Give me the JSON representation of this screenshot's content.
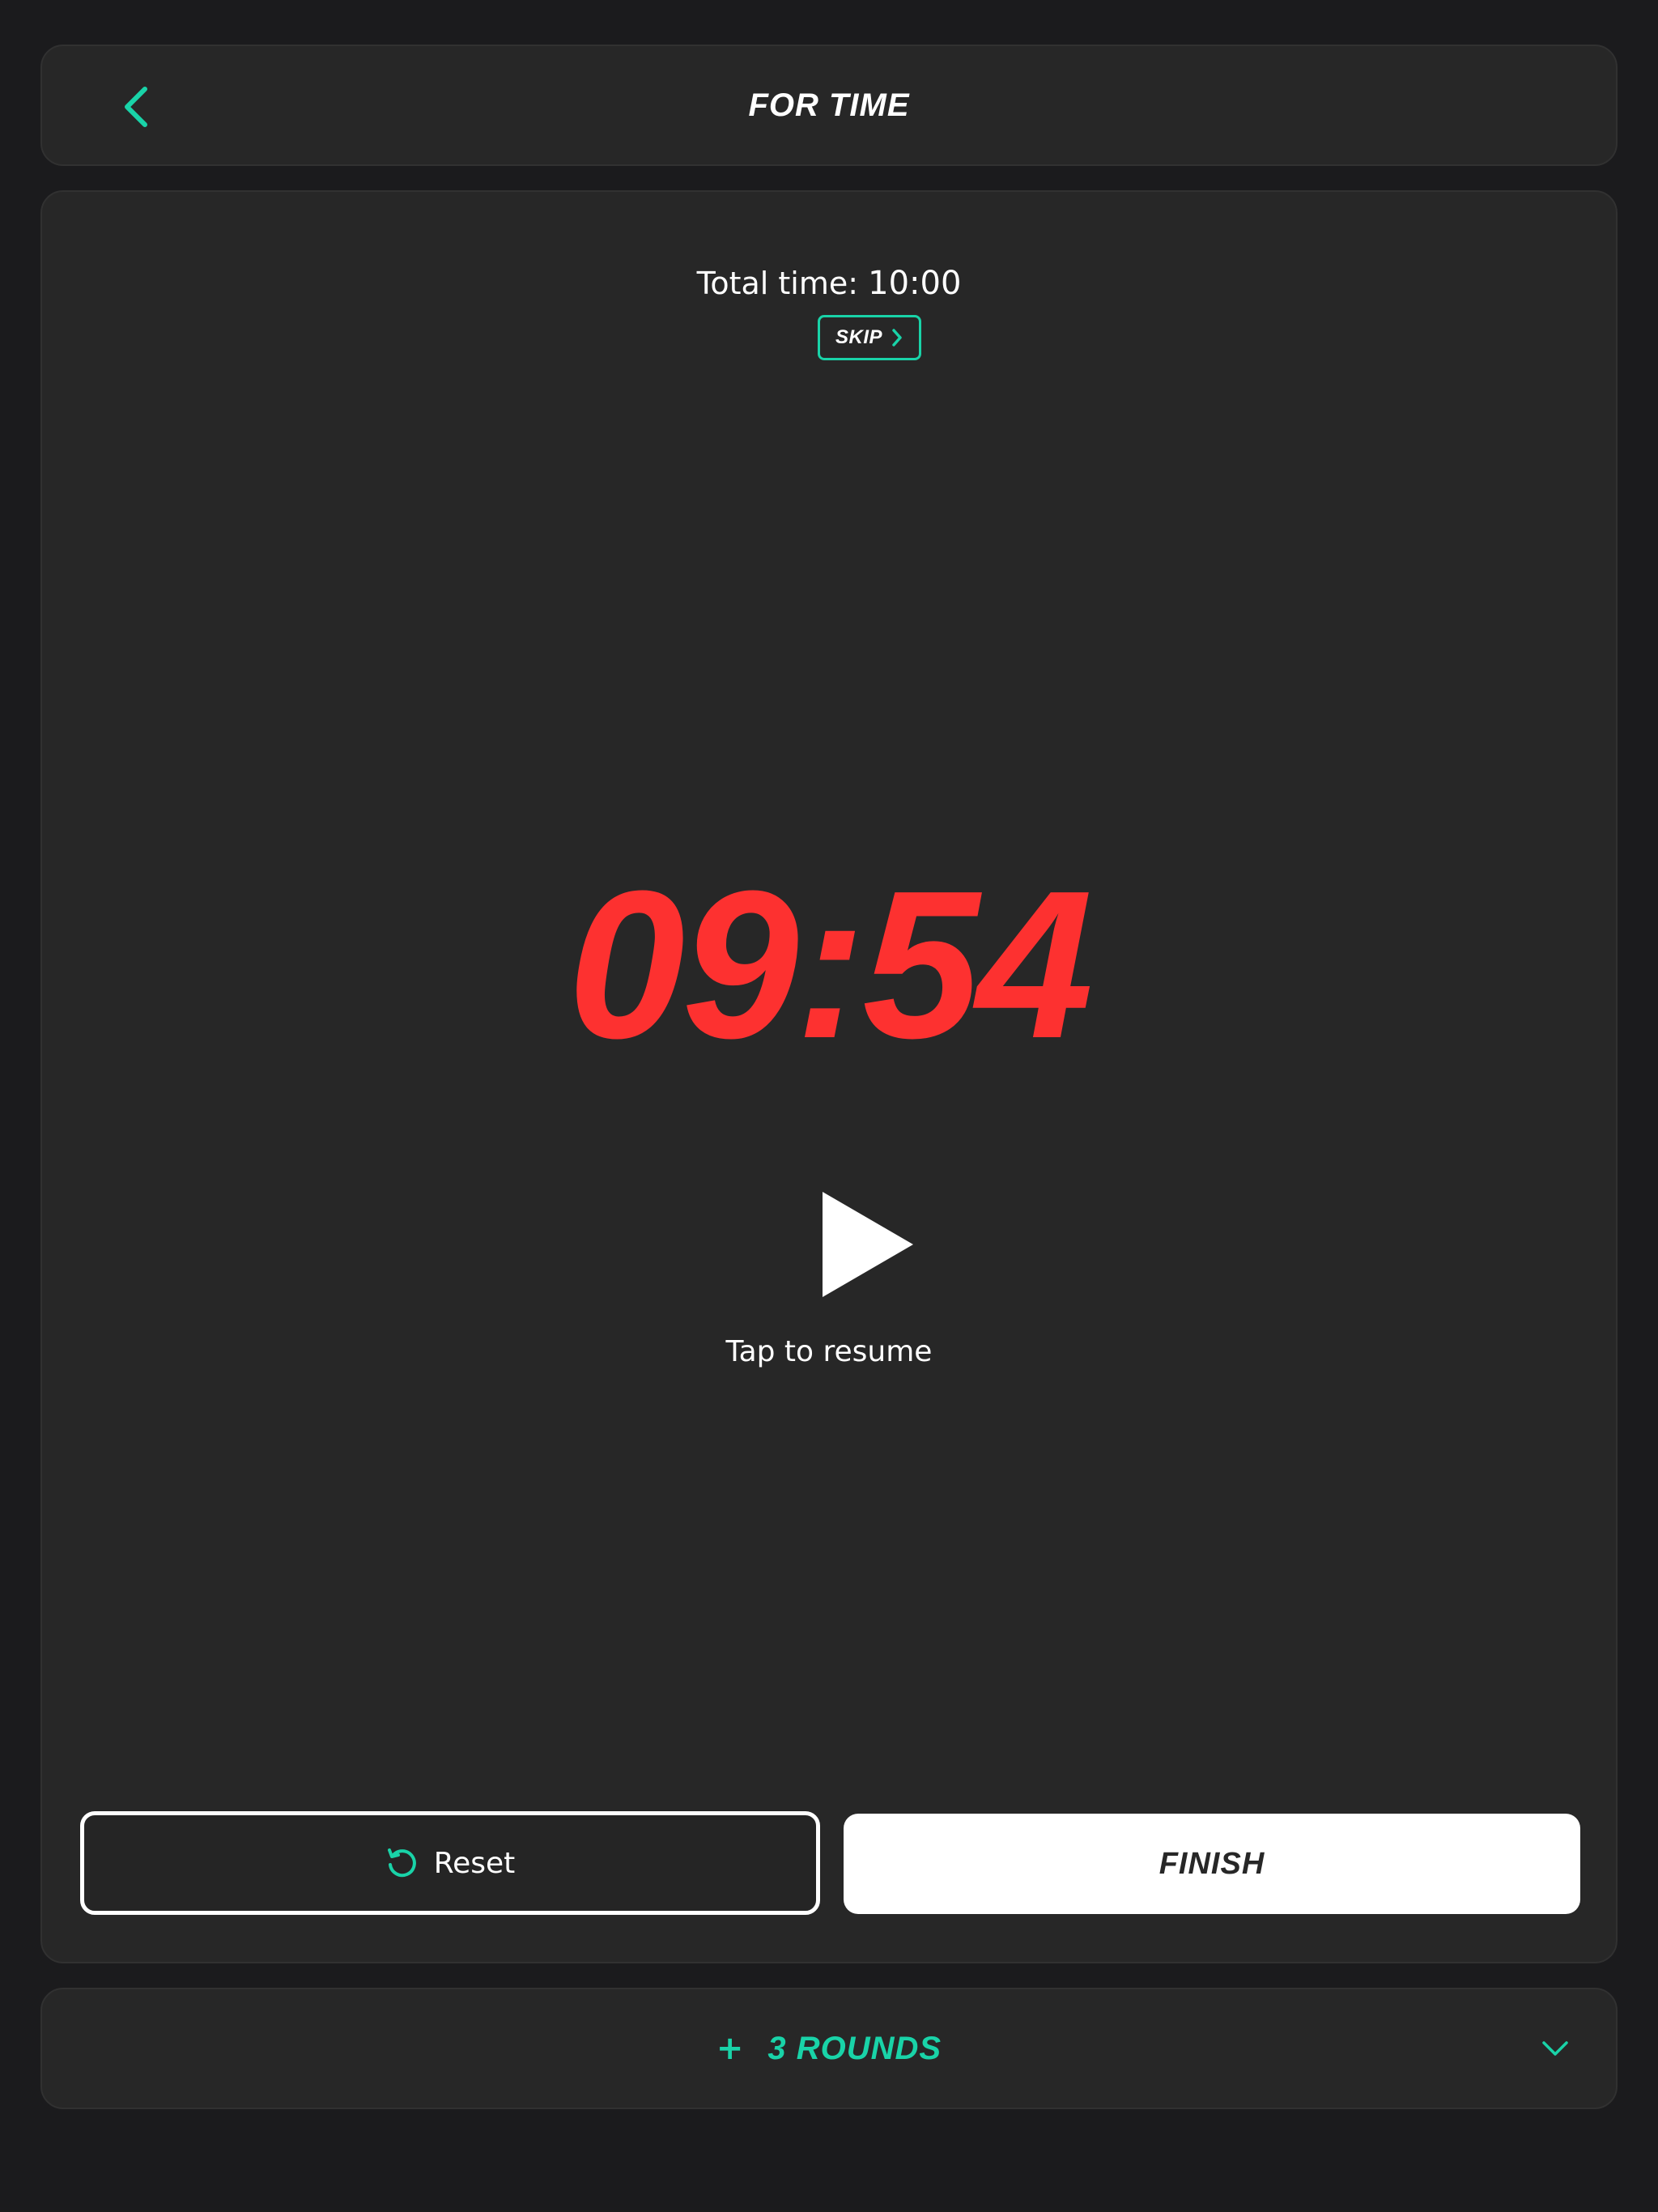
{
  "header": {
    "title": "FOR TIME",
    "back_icon": "chevron-left-icon"
  },
  "main": {
    "total_time_label": "Total time:",
    "total_time_value": "10:00",
    "skip_label": "SKIP",
    "timer": "09:54",
    "resume_text": "Tap to resume",
    "reset_label": "Reset",
    "finish_label": "FINISH"
  },
  "rounds": {
    "plus": "+",
    "label": "3 ROUNDS"
  },
  "colors": {
    "accent": "#19d3a8",
    "timer": "#fd3130",
    "background": "#1b1b1d",
    "card": "#272727"
  }
}
